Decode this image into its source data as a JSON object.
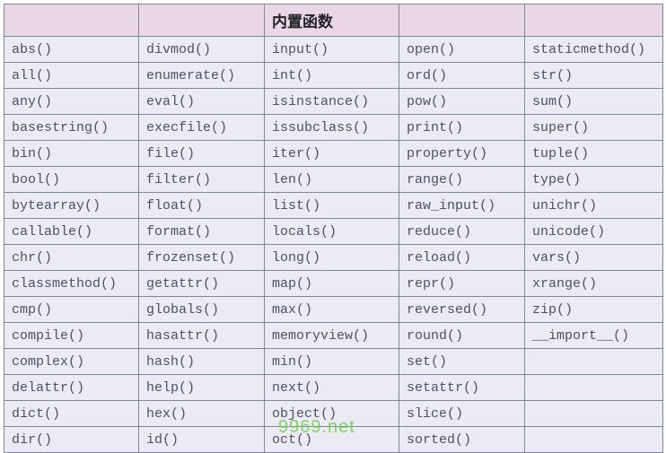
{
  "header": {
    "col1": "",
    "col2": "",
    "col3": "内置函数",
    "col4": "",
    "col5": ""
  },
  "rows": [
    [
      "abs()",
      "divmod()",
      "input()",
      "open()",
      "staticmethod()"
    ],
    [
      "all()",
      "enumerate()",
      "int()",
      "ord()",
      "str()"
    ],
    [
      "any()",
      "eval()",
      "isinstance()",
      "pow()",
      "sum()"
    ],
    [
      "basestring()",
      "execfile()",
      "issubclass()",
      "print()",
      "super()"
    ],
    [
      "bin()",
      "file()",
      "iter()",
      "property()",
      "tuple()"
    ],
    [
      "bool()",
      "filter()",
      "len()",
      "range()",
      "type()"
    ],
    [
      "bytearray()",
      "float()",
      "list()",
      "raw_input()",
      "unichr()"
    ],
    [
      "callable()",
      "format()",
      "locals()",
      "reduce()",
      "unicode()"
    ],
    [
      "chr()",
      "frozenset()",
      "long()",
      "reload()",
      "vars()"
    ],
    [
      "classmethod()",
      "getattr()",
      "map()",
      "repr()",
      "xrange()"
    ],
    [
      "cmp()",
      "globals()",
      "max()",
      "reversed()",
      "zip()"
    ],
    [
      "compile()",
      "hasattr()",
      "memoryview()",
      "round()",
      "__import__()"
    ],
    [
      "complex()",
      "hash()",
      "min()",
      "set()",
      ""
    ],
    [
      "delattr()",
      "help()",
      "next()",
      "setattr()",
      ""
    ],
    [
      "dict()",
      "hex()",
      "object()",
      "slice()",
      ""
    ],
    [
      "dir()",
      "id()",
      "oct()",
      "sorted()",
      ""
    ]
  ],
  "watermark": "9969.net"
}
